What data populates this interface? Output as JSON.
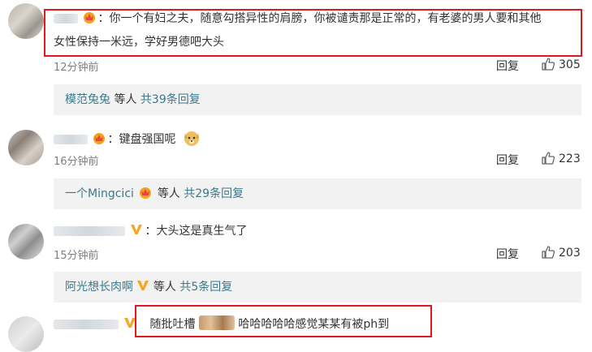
{
  "comments": [
    {
      "text_line1": "你一个有妇之夫，随意勾搭异性的肩膀，你被谴责那是正常的，有老婆的男人要和其他",
      "text_line2": "女性保持一米远，学好男德吧大头",
      "time": "12分钟前",
      "reply_label": "回复",
      "likes": "305",
      "badge_icon": "vip-crown-icon",
      "sub": {
        "user": "模范兔兔",
        "mid": "等人",
        "count": "共39条回复"
      }
    },
    {
      "text_line1": "键盘强国呢",
      "time": "16分钟前",
      "reply_label": "回复",
      "likes": "223",
      "badge_icon": "vip-crown-icon",
      "emoji_icon": "doge-emoji-icon",
      "sub": {
        "user": "一个Mingcici",
        "mid": "等人",
        "count": "共29条回复"
      }
    },
    {
      "text_line1": "大头这是真生气了",
      "time": "15分钟前",
      "reply_label": "回复",
      "likes": "203",
      "badge_icon": "verified-v-icon",
      "sub": {
        "user": "阿光想长肉啊",
        "mid": "等人",
        "count": "共5条回复"
      }
    },
    {
      "text_line1": "随批吐槽",
      "text_line1b": "哈哈哈哈哈感觉某某有被ph到",
      "badge_icon": "verified-v-icon"
    }
  ],
  "colors": {
    "highlight_box": "#e0191c",
    "link": "#3a7a8c",
    "sub_bg": "#f2f2f2"
  }
}
